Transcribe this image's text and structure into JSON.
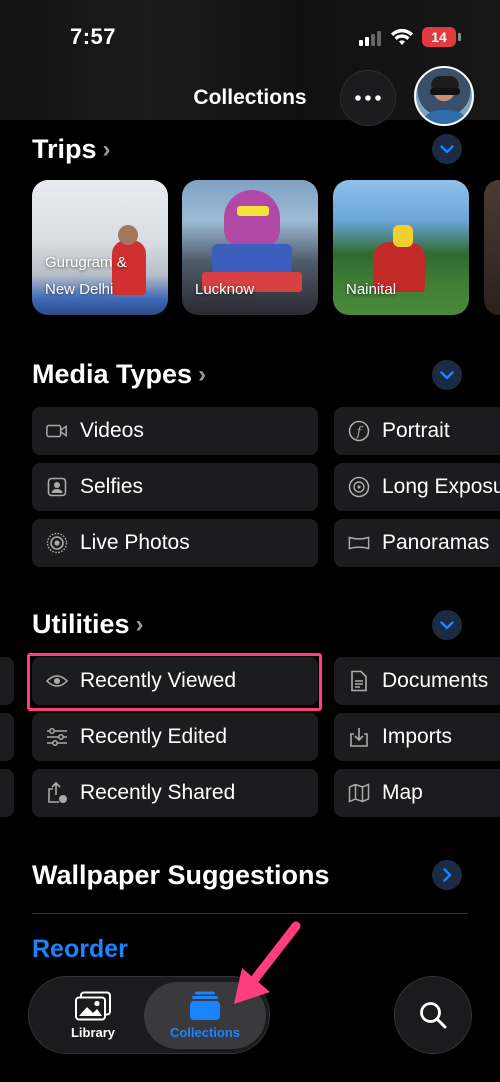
{
  "status_bar": {
    "time": "7:57",
    "battery": "14"
  },
  "header": {
    "title": "Collections"
  },
  "trips": {
    "title": "Trips",
    "items": [
      {
        "label_line1": "Gurugram &",
        "label_line2": "New Delhi"
      },
      {
        "label_line1": "Lucknow",
        "label_line2": ""
      },
      {
        "label_line1": "Nainital",
        "label_line2": ""
      }
    ]
  },
  "media_types": {
    "title": "Media Types",
    "items": [
      {
        "label": "Videos",
        "icon": "video-icon"
      },
      {
        "label": "Portrait",
        "icon": "portrait-f-icon"
      },
      {
        "label": "Selfies",
        "icon": "selfie-icon"
      },
      {
        "label": "Long Exposure",
        "icon": "long-exposure-icon"
      },
      {
        "label": "Live Photos",
        "icon": "live-photo-icon"
      },
      {
        "label": "Panoramas",
        "icon": "panorama-icon"
      }
    ]
  },
  "utilities": {
    "title": "Utilities",
    "items": [
      {
        "label": "Recently Viewed",
        "icon": "eye-icon"
      },
      {
        "label": "Documents",
        "icon": "document-icon"
      },
      {
        "label": "Recently Edited",
        "icon": "sliders-icon"
      },
      {
        "label": "Imports",
        "icon": "import-icon"
      },
      {
        "label": "Recently Shared",
        "icon": "share-icon"
      },
      {
        "label": "Map",
        "icon": "map-icon"
      }
    ]
  },
  "wallpaper": {
    "title": "Wallpaper Suggestions"
  },
  "reorder_label": "Reorder",
  "tabbar": {
    "library": "Library",
    "collections": "Collections"
  },
  "colors": {
    "accent": "#1a84ff",
    "highlight": "#ff3d7f",
    "tile": "#1c1c1e"
  }
}
